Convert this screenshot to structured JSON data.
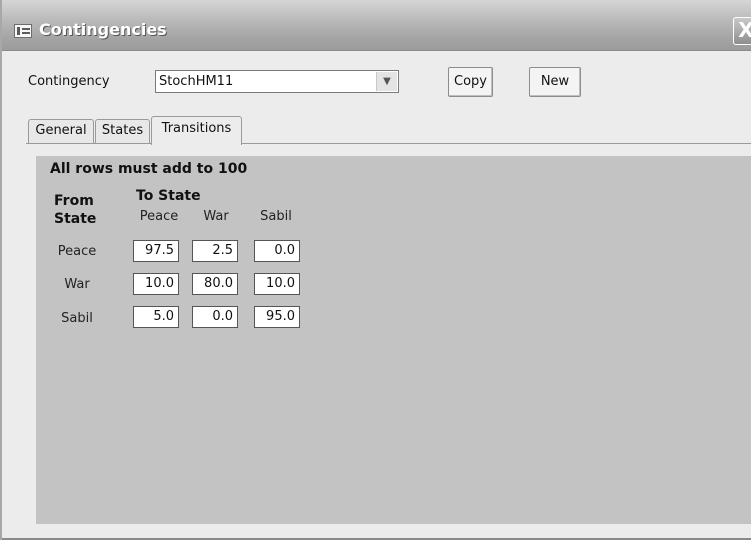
{
  "window": {
    "title": "Contingencies",
    "close_label": "X"
  },
  "form": {
    "contingency_label": "Contingency",
    "contingency_value": "StochHM11",
    "copy_label": "Copy",
    "new_label": "New"
  },
  "tabs": [
    {
      "label": "General",
      "active": false
    },
    {
      "label": "States",
      "active": false
    },
    {
      "label": "Transitions",
      "active": true
    }
  ],
  "transitions": {
    "note": "All rows must add to 100",
    "from_header_line1": "From",
    "from_header_line2": "State",
    "to_header": "To State",
    "columns": [
      "Peace",
      "War",
      "Sabil"
    ],
    "rows": [
      {
        "label": "Peace",
        "values": [
          "97.5",
          "2.5",
          "0.0"
        ]
      },
      {
        "label": "War",
        "values": [
          "10.0",
          "80.0",
          "10.0"
        ]
      },
      {
        "label": "Sabil",
        "values": [
          "5.0",
          "0.0",
          "95.0"
        ]
      }
    ]
  }
}
